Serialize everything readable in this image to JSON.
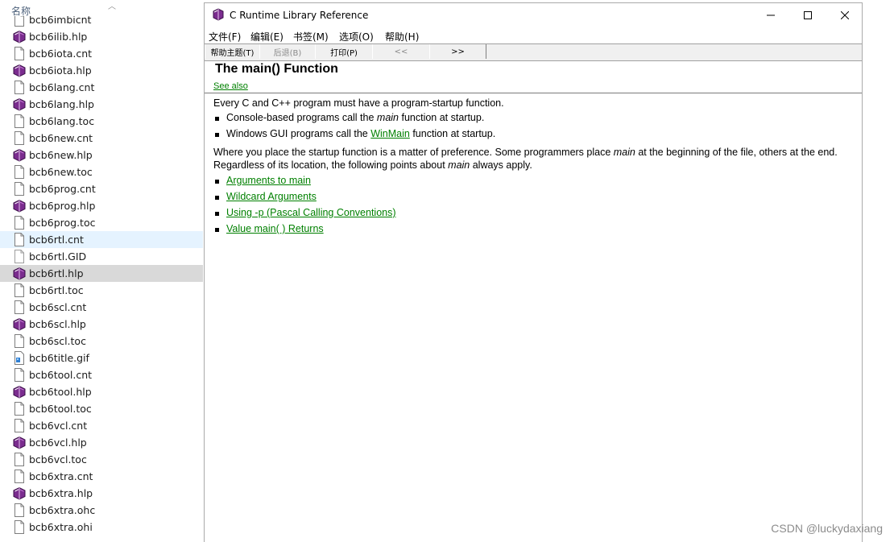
{
  "explorer": {
    "column_header": "名称",
    "files": [
      {
        "name": "bcb6imbicnt",
        "icon": "text-file-icon"
      },
      {
        "name": "bcb6ilib.hlp",
        "icon": "help-book-icon"
      },
      {
        "name": "bcb6iota.cnt",
        "icon": "text-file-icon"
      },
      {
        "name": "bcb6iota.hlp",
        "icon": "help-book-icon"
      },
      {
        "name": "bcb6lang.cnt",
        "icon": "text-file-icon"
      },
      {
        "name": "bcb6lang.hlp",
        "icon": "help-book-icon"
      },
      {
        "name": "bcb6lang.toc",
        "icon": "text-file-icon"
      },
      {
        "name": "bcb6new.cnt",
        "icon": "text-file-icon"
      },
      {
        "name": "bcb6new.hlp",
        "icon": "help-book-icon"
      },
      {
        "name": "bcb6new.toc",
        "icon": "text-file-icon"
      },
      {
        "name": "bcb6prog.cnt",
        "icon": "text-file-icon"
      },
      {
        "name": "bcb6prog.hlp",
        "icon": "help-book-icon"
      },
      {
        "name": "bcb6prog.toc",
        "icon": "text-file-icon"
      },
      {
        "name": "bcb6rtl.cnt",
        "icon": "text-file-icon",
        "state": "hover"
      },
      {
        "name": "bcb6rtl.GID",
        "icon": "blank-file-icon"
      },
      {
        "name": "bcb6rtl.hlp",
        "icon": "help-book-icon",
        "state": "selected"
      },
      {
        "name": "bcb6rtl.toc",
        "icon": "text-file-icon"
      },
      {
        "name": "bcb6scl.cnt",
        "icon": "text-file-icon"
      },
      {
        "name": "bcb6scl.hlp",
        "icon": "help-book-icon"
      },
      {
        "name": "bcb6scl.toc",
        "icon": "text-file-icon"
      },
      {
        "name": "bcb6title.gif",
        "icon": "image-file-icon"
      },
      {
        "name": "bcb6tool.cnt",
        "icon": "text-file-icon"
      },
      {
        "name": "bcb6tool.hlp",
        "icon": "help-book-icon"
      },
      {
        "name": "bcb6tool.toc",
        "icon": "text-file-icon"
      },
      {
        "name": "bcb6vcl.cnt",
        "icon": "text-file-icon"
      },
      {
        "name": "bcb6vcl.hlp",
        "icon": "help-book-icon"
      },
      {
        "name": "bcb6vcl.toc",
        "icon": "text-file-icon"
      },
      {
        "name": "bcb6xtra.cnt",
        "icon": "text-file-icon"
      },
      {
        "name": "bcb6xtra.hlp",
        "icon": "help-book-icon"
      },
      {
        "name": "bcb6xtra.ohc",
        "icon": "text-file-icon"
      },
      {
        "name": "bcb6xtra.ohi",
        "icon": "text-file-icon"
      }
    ]
  },
  "help_window": {
    "title": "C Runtime Library Reference",
    "menu": [
      "文件(F)",
      "编辑(E)",
      "书签(M)",
      "选项(O)",
      "帮助(H)"
    ],
    "toolbar": {
      "contents": "帮助主题(T)",
      "back": "后退(B)",
      "print": "打印(P)",
      "prev": "<<",
      "next": ">>"
    },
    "topic_title": "The main() Function",
    "see_also": "See also",
    "intro": "Every C and C++ program must have a program-startup function.",
    "bullet1": {
      "before": "Console-based programs call the ",
      "em": "main",
      "after": " function at startup."
    },
    "bullet2": {
      "before": "Windows GUI programs call the ",
      "link": "WinMain",
      "after": " function at startup."
    },
    "para2": {
      "p1": "Where you place the startup function is a matter of preference. Some programmers place ",
      "em1": "main",
      "p2": " at the beginning of the file, others at the end. Regardless of its location, the following points about ",
      "em2": "main",
      "p3": " always apply."
    },
    "links": [
      "Arguments to main",
      "Wildcard Arguments",
      "Using -p (Pascal Calling Conventions)",
      "Value main( ) Returns"
    ]
  },
  "watermark": "CSDN @luckydaxiang",
  "colors": {
    "link": "#008000",
    "selected_row": "#d9d9d9",
    "hover_row": "#e5f3ff",
    "help_book": "#7b2c8f"
  }
}
